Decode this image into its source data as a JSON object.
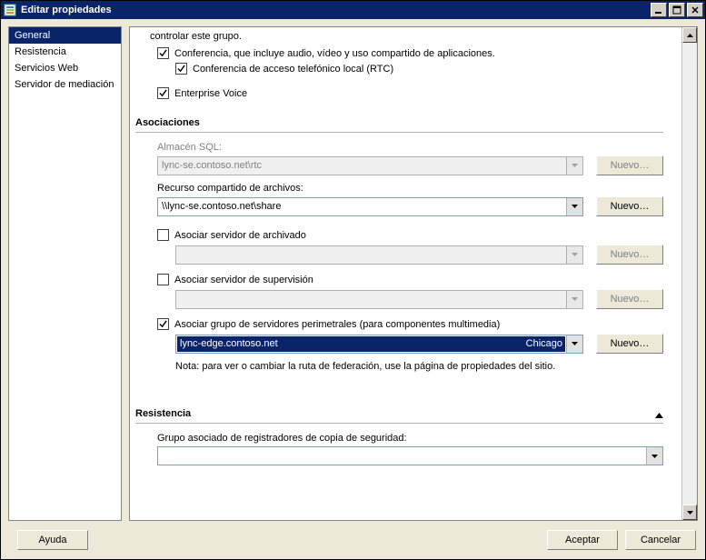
{
  "window": {
    "title": "Editar propiedades"
  },
  "sidebar": {
    "items": [
      {
        "label": "General",
        "selected": true
      },
      {
        "label": "Resistencia",
        "selected": false
      },
      {
        "label": "Servicios Web",
        "selected": false
      },
      {
        "label": "Servidor de mediación",
        "selected": false
      }
    ]
  },
  "top": {
    "truncated": "controlar este grupo.",
    "chk_conf": "Conferencia, que incluye audio, vídeo y uso compartido de aplicaciones.",
    "chk_pstn": "Conferencia de acceso telefónico local (RTC)",
    "chk_ev": "Enterprise Voice"
  },
  "assoc": {
    "header": "Asociaciones",
    "sql_label": "Almacén SQL:",
    "sql_value": "lync-se.contoso.net\\rtc",
    "fileshare_label": "Recurso compartido de archivos:",
    "fileshare_value": "\\\\lync-se.contoso.net\\share",
    "chk_archive": "Asociar servidor de archivado",
    "chk_monitor": "Asociar servidor de supervisión",
    "chk_edge": "Asociar grupo de servidores perimetrales (para componentes multimedia)",
    "edge_value": "lync-edge.contoso.net",
    "edge_right": "Chicago",
    "note": "Nota: para ver o cambiar la ruta de federación, use la página de propiedades del sitio.",
    "btn_new": "Nuevo…"
  },
  "resilience": {
    "header": "Resistencia",
    "backup_label": "Grupo asociado de registradores de copia de seguridad:"
  },
  "buttons": {
    "help": "Ayuda",
    "ok": "Aceptar",
    "cancel": "Cancelar"
  }
}
